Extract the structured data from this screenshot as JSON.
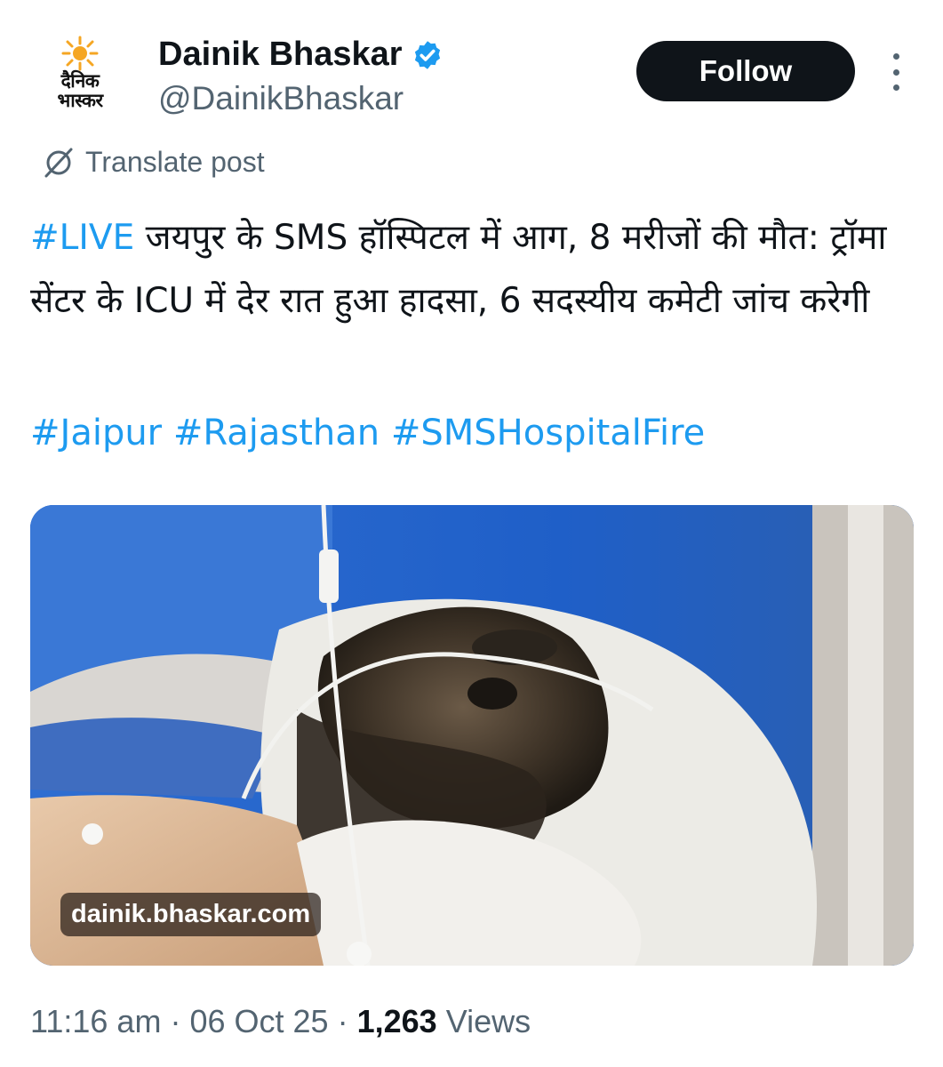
{
  "account": {
    "logo_text_line1": "दैनिक",
    "logo_text_line2": "भास्कर",
    "display_name": "Dainik Bhaskar",
    "handle": "@DainikBhaskar",
    "verified_color": "#1d9bf0"
  },
  "actions": {
    "follow_label": "Follow",
    "translate_label": "Translate post"
  },
  "post": {
    "live_tag": "#LIVE",
    "body": " जयपुर के SMS हॉस्पिटल में आग, 8 मरीजों की मौत: ट्रॉमा सेंटर के ICU में देर रात हुआ हादसा, 6 सदस्यीय कमेटी जांच करेगी",
    "hashtags": [
      "#Jaipur",
      "#Rajasthan",
      "#SMSHospitalFire"
    ]
  },
  "media": {
    "credit": "dainik.bhaskar.com"
  },
  "meta": {
    "time": "11:16 am",
    "date": "06 Oct 25",
    "views_count": "1,263",
    "views_label": "Views",
    "separator": "·"
  },
  "colors": {
    "accent": "#1d9bf0",
    "text_primary": "#0f1419",
    "text_secondary": "#536471",
    "button_dark": "#0f1419"
  }
}
